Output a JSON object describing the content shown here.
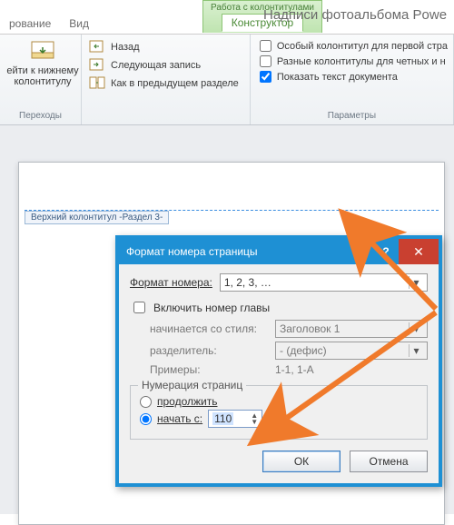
{
  "ribbon": {
    "context_group": "Работа с колонтитулами",
    "context_tab": "Конструктор",
    "tab_left_a": "рование",
    "tab_left_b": "Вид",
    "title_right": "Надписи  фотоальбома Powe"
  },
  "transitions": {
    "goto_lower": "ейти к нижнему\nколонтитулу",
    "back": "Назад",
    "next": "Следующая запись",
    "prev_section": "Как в предыдущем разделе",
    "group_label": "Переходы"
  },
  "options": {
    "first_page": "Особый колонтитул для первой стра",
    "odd_even": "Разные колонтитулы для четных и н",
    "show_doc": "Показать текст документа",
    "group_label": "Параметры"
  },
  "header_tag": "Верхний колонтитул -Раздел 3-",
  "dialog": {
    "title": "Формат номера страницы",
    "format_label": "Формат номера:",
    "format_value": "1, 2, 3, …",
    "include_chapter": "Включить номер главы",
    "starts_style_label": "начинается со стиля:",
    "starts_style_value": "Заголовок 1",
    "separator_label": "разделитель:",
    "separator_value": "-   (дефис)",
    "examples_label": "Примеры:",
    "examples_value": "1-1, 1-A",
    "numbering_legend": "Нумерация страниц",
    "radio_continue": "продолжить",
    "radio_start": "начать с:",
    "start_value": "110",
    "ok": "ОК",
    "cancel": "Отмена"
  }
}
